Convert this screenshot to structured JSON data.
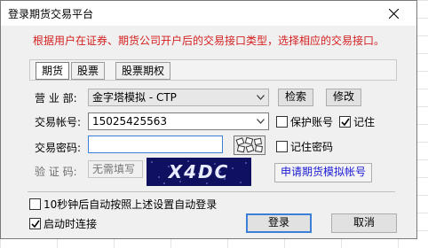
{
  "window": {
    "title": "登录期货交易平台"
  },
  "notice": "根据用户在证券、期货公司开户后的交易接口类型，选择相应的交易接口。",
  "tabs": [
    {
      "label": "期货",
      "active": true
    },
    {
      "label": "股票",
      "active": false
    },
    {
      "label": "股票期权",
      "active": false
    }
  ],
  "business_dept": {
    "label": "营 业 部:",
    "value": "金字塔模拟 - CTP",
    "search_button": "检索",
    "modify_button": "修改"
  },
  "account": {
    "label": "交易帐号:",
    "value": "15025425563",
    "protect_label": "保护账号",
    "protect_checked": false,
    "remember_label": "记住",
    "remember_checked": true
  },
  "password": {
    "label": "交易密码:",
    "value": "",
    "keypad_icon": "keypad-icon",
    "remember_label": "记住密码",
    "remember_checked": false
  },
  "captcha": {
    "label": "验 证 码:",
    "placeholder": "无需填写",
    "image_text": "X4DC",
    "apply_link": "申请期货模拟帐号"
  },
  "options": {
    "auto_login_label": "10秒钟后自动按照上述设置自动登录",
    "auto_login_checked": false,
    "connect_on_start_label": "启动时连接",
    "connect_on_start_checked": true
  },
  "buttons": {
    "login": "登录",
    "cancel": "取消"
  },
  "colors": {
    "notice": "#d42020",
    "link_button": "#1a1ad6",
    "captcha_bg": "#101060"
  }
}
